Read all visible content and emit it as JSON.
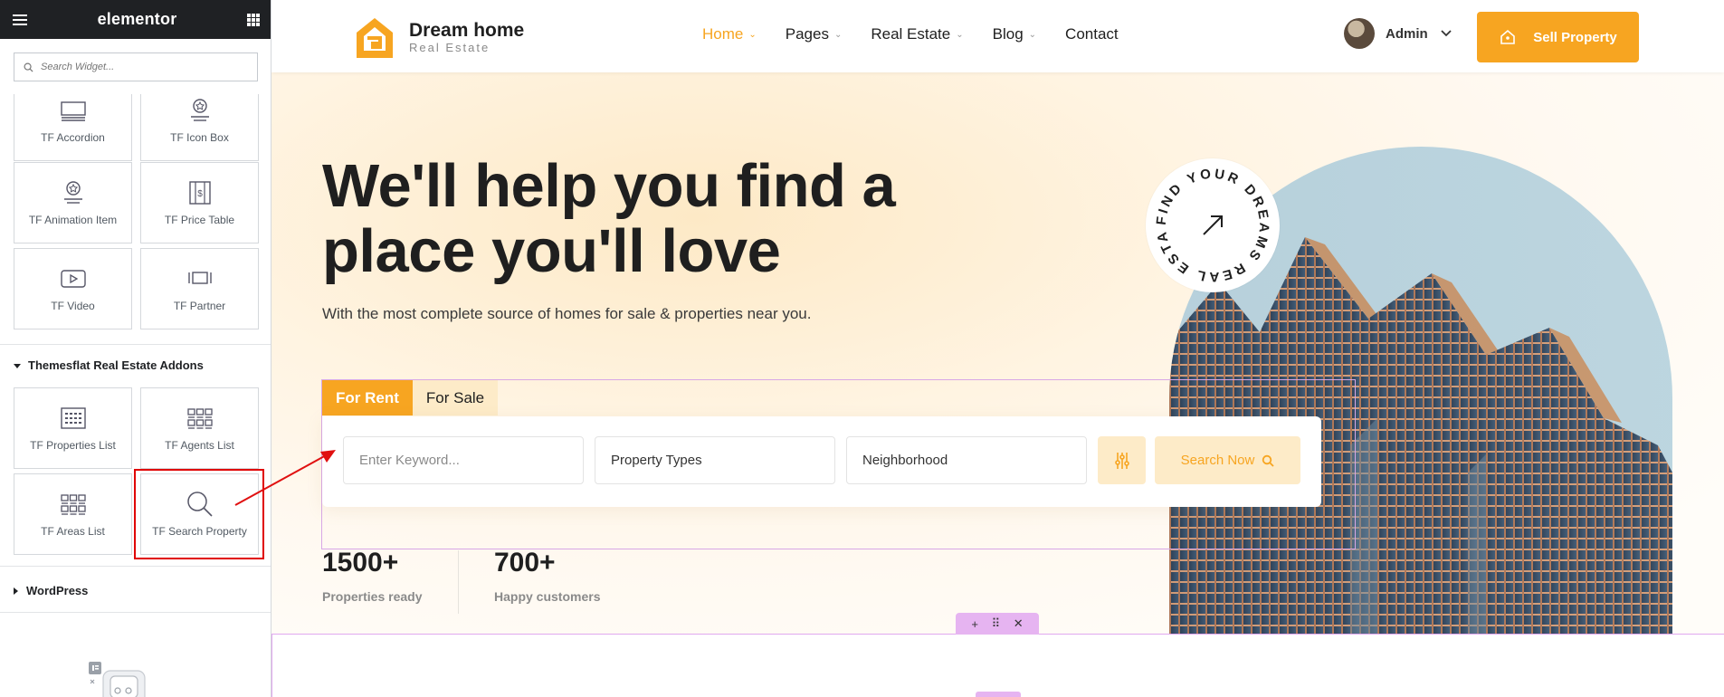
{
  "editor": {
    "brand": "elementor",
    "search_placeholder": "Search Widget...",
    "widgets_top": [
      {
        "label": "TF Accordion",
        "icon": "accordion-icon"
      },
      {
        "label": "TF Icon Box",
        "icon": "icon-box-icon"
      },
      {
        "label": "TF Animation Item",
        "icon": "animation-item-icon"
      },
      {
        "label": "TF Price Table",
        "icon": "price-table-icon"
      },
      {
        "label": "TF Video",
        "icon": "video-icon"
      },
      {
        "label": "TF Partner",
        "icon": "partner-icon"
      }
    ],
    "category_addons": "Themesflat Real Estate Addons",
    "widgets_addons": [
      {
        "label": "TF Properties List",
        "icon": "properties-list-icon"
      },
      {
        "label": "TF Agents List",
        "icon": "agents-list-icon"
      },
      {
        "label": "TF Areas List",
        "icon": "areas-list-icon"
      },
      {
        "label": "TF Search Property",
        "icon": "search-property-icon"
      }
    ],
    "category_wordpress": "WordPress"
  },
  "site": {
    "logo_name": "Dream home",
    "logo_sub": "Real Estate",
    "nav": [
      {
        "label": "Home",
        "active": true,
        "caret": true
      },
      {
        "label": "Pages",
        "active": false,
        "caret": true
      },
      {
        "label": "Real Estate",
        "active": false,
        "caret": true
      },
      {
        "label": "Blog",
        "active": false,
        "caret": true
      },
      {
        "label": "Contact",
        "active": false,
        "caret": false
      }
    ],
    "user_name": "Admin",
    "sell_button": "Sell Property",
    "accent": "#f7a521"
  },
  "hero": {
    "headline_line1": "We'll help you find a",
    "headline_line2": "place you'll love",
    "subline": "With the most complete source of homes for sale & properties near you.",
    "badge_text": "FIND YOUR DREAMS REAL ESTATE",
    "tabs": [
      "For Rent",
      "For Sale"
    ],
    "keyword_placeholder": "Enter Keyword...",
    "property_types": "Property Types",
    "neighborhood": "Neighborhood",
    "search_button": "Search Now",
    "stats": [
      {
        "value": "1500+",
        "label": "Properties ready"
      },
      {
        "value": "700+",
        "label": "Happy customers"
      }
    ]
  }
}
